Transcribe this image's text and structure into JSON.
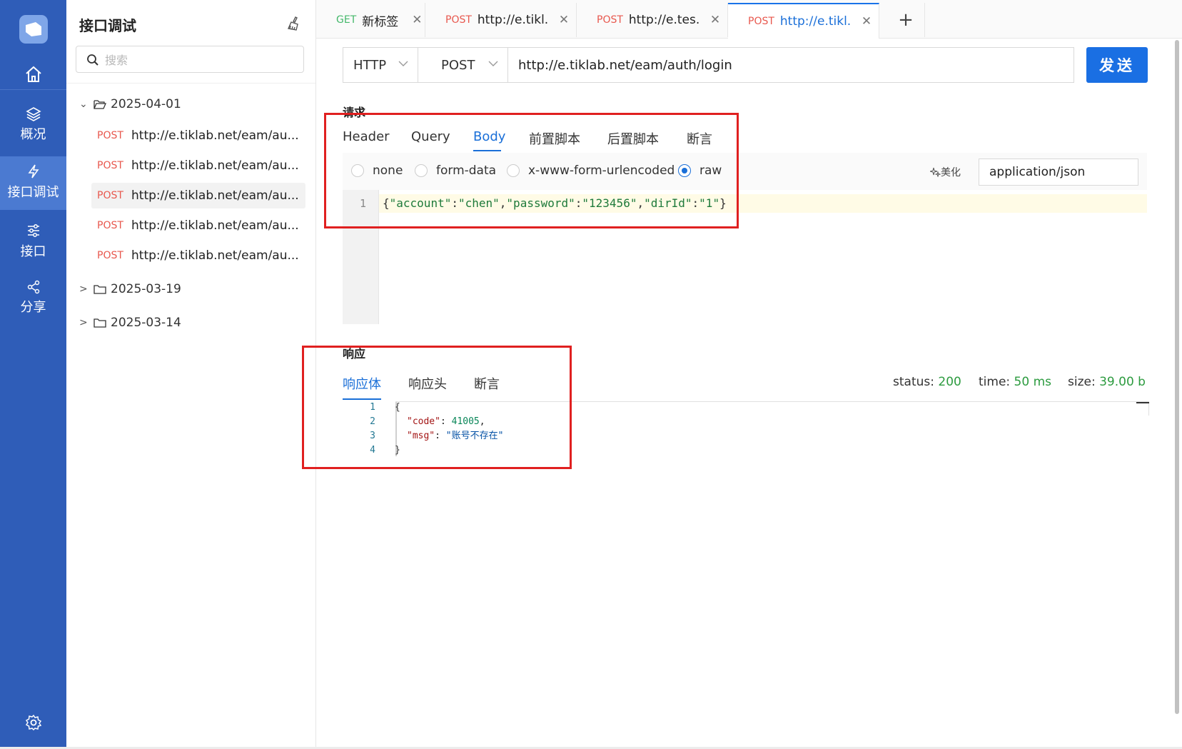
{
  "nav": {
    "items": [
      {
        "label": "",
        "icon": "home-icon"
      },
      {
        "label": "概况",
        "icon": "layers-icon"
      },
      {
        "label": "接口调试",
        "icon": "lightning-icon"
      },
      {
        "label": "接口",
        "icon": "sliders-icon"
      },
      {
        "label": "分享",
        "icon": "share-icon"
      }
    ],
    "active_index": 2,
    "settings_icon": "gear-icon",
    "background": "#2f5db8"
  },
  "sidebar": {
    "title": "接口调试",
    "search_placeholder": "搜索",
    "folders": [
      {
        "name": "2025-04-01",
        "expanded": true,
        "requests": [
          {
            "method": "POST",
            "url": "http://e.tiklab.net/eam/au..."
          },
          {
            "method": "POST",
            "url": "http://e.tiklab.net/eam/au..."
          },
          {
            "method": "POST",
            "url": "http://e.tiklab.net/eam/au...",
            "selected": true
          },
          {
            "method": "POST",
            "url": "http://e.tiklab.net/eam/au..."
          },
          {
            "method": "POST",
            "url": "http://e.tiklab.net/eam/au..."
          }
        ]
      },
      {
        "name": "2025-03-19",
        "expanded": false
      },
      {
        "name": "2025-03-14",
        "expanded": false
      }
    ]
  },
  "tabs": [
    {
      "method": "GET",
      "title": "新标签"
    },
    {
      "method": "POST",
      "title": "http://e.tikl..."
    },
    {
      "method": "POST",
      "title": "http://e.tes..."
    },
    {
      "method": "POST",
      "title": "http://e.tikl...",
      "active": true
    }
  ],
  "tab_add": "+",
  "urlbar": {
    "protocol": "HTTP",
    "method": "POST",
    "url": "http://e.tiklab.net/eam/auth/login",
    "send_label": "发送"
  },
  "request": {
    "section_title": "请求",
    "tabs": [
      "Header",
      "Query",
      "Body",
      "前置脚本",
      "后置脚本",
      "断言"
    ],
    "active_tab": "Body",
    "body_types": [
      "none",
      "form-data",
      "x-www-form-urlencoded",
      "raw"
    ],
    "selected_body_type": "raw",
    "beautify_label": "美化",
    "content_type": "application/json",
    "line_number": "1",
    "body": "{\"account\":\"chen\",\"password\":\"123456\",\"dirId\":\"1\"}"
  },
  "response": {
    "section_title": "响应",
    "tabs": [
      "响应体",
      "响应头",
      "断言"
    ],
    "active_tab": "响应体",
    "status_label": "status:",
    "status": "200",
    "time_label": "time:",
    "time": "50 ms",
    "size_label": "size:",
    "size": "39.00 b",
    "lines": [
      "{",
      "\"code\": 41005,",
      "\"msg\": \"账号不存在\"",
      "}"
    ],
    "line_numbers": [
      "1",
      "2",
      "3",
      "4"
    ]
  },
  "colors": {
    "accent": "#1a6fd8",
    "post": "#e8584e",
    "get": "#45b86b",
    "highlight_box": "#e02020"
  }
}
